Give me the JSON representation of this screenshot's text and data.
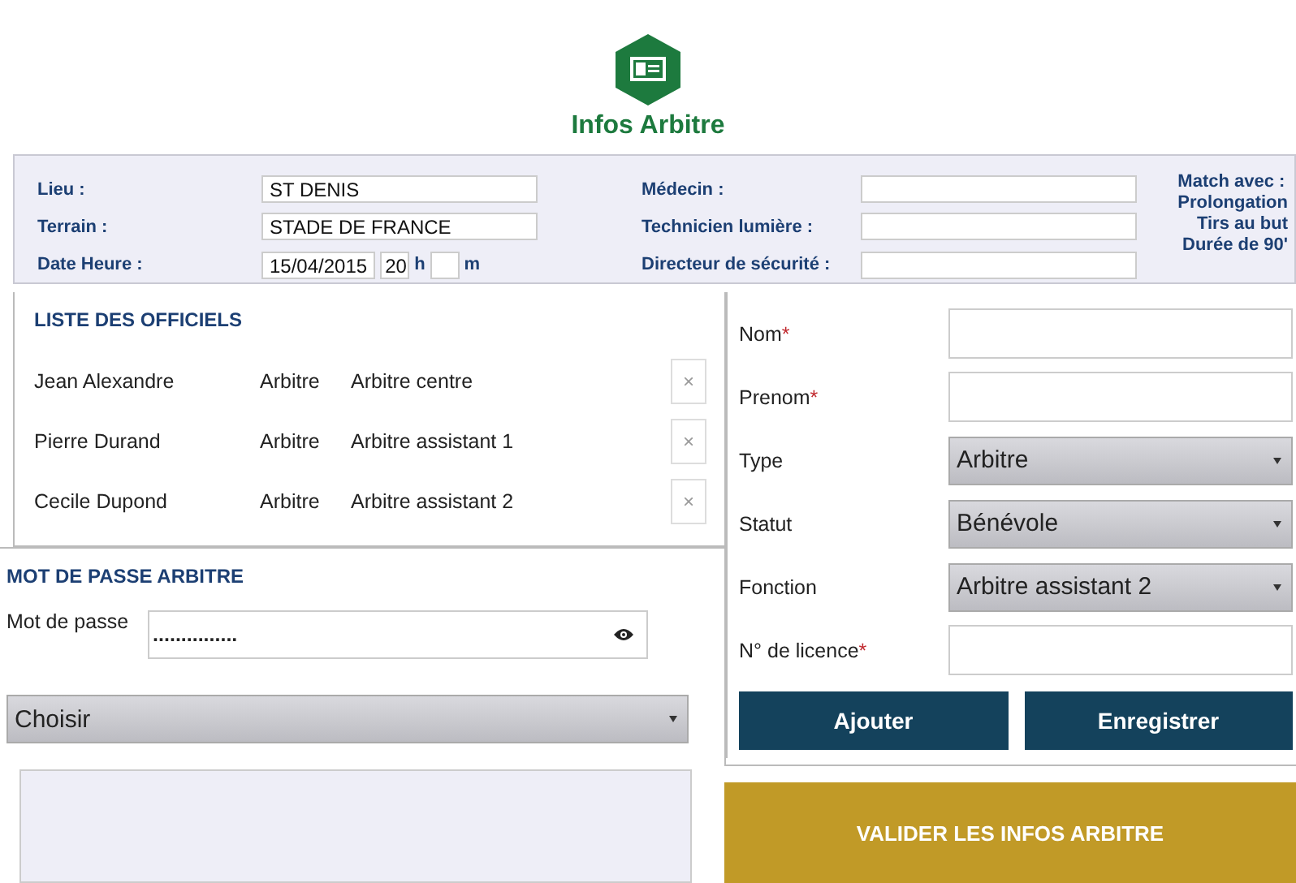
{
  "header": {
    "title": "Infos Arbitre"
  },
  "match_info": {
    "left": [
      {
        "kind": "text",
        "label": "Lieu :",
        "value": "ST DENIS"
      },
      {
        "kind": "text",
        "label": "Terrain :",
        "value": "STADE DE FRANCE"
      },
      {
        "kind": "datetime",
        "label": "Date Heure :",
        "date": "15/04/2015",
        "hour": "20",
        "hour_unit": "h",
        "minute_unit": "m"
      }
    ],
    "middle": [
      {
        "label": "Médecin :"
      },
      {
        "label": "Technicien lumière :"
      },
      {
        "label": "Directeur de sécurité :"
      }
    ],
    "match_with": {
      "title": "Match avec :",
      "options": [
        "Prolongation",
        "Tirs au but",
        "Durée de 90'"
      ]
    }
  },
  "officials": {
    "title": "LISTE DES OFFICIELS",
    "rows": [
      {
        "name": "Jean Alexandre",
        "type": "Arbitre",
        "function": "Arbitre centre",
        "remove": "×"
      },
      {
        "name": "Pierre Durand",
        "type": "Arbitre",
        "function": "Arbitre assistant 1",
        "remove": "×"
      },
      {
        "name": "Cecile Dupond",
        "type": "Arbitre",
        "function": "Arbitre assistant 2",
        "remove": "×"
      }
    ]
  },
  "password": {
    "title": "MOT DE PASSE ARBITRE",
    "label": "Mot de passe",
    "value": "...............",
    "select": "Choisir"
  },
  "form": {
    "fields": [
      {
        "kind": "text",
        "label": "Nom",
        "required_mark": "*"
      },
      {
        "kind": "text",
        "label": "Prenom",
        "required_mark": "*"
      },
      {
        "kind": "select",
        "label": "Type",
        "value": "Arbitre"
      },
      {
        "kind": "select",
        "label": "Statut",
        "value": "Bénévole"
      },
      {
        "kind": "select",
        "label": "Fonction",
        "value": "Arbitre assistant 2"
      },
      {
        "kind": "text",
        "label": "N° de licence",
        "required_mark": "*"
      }
    ],
    "buttons": [
      "Ajouter",
      "Enregistrer"
    ]
  },
  "validate_button": "VALIDER LES INFOS ARBITRE"
}
